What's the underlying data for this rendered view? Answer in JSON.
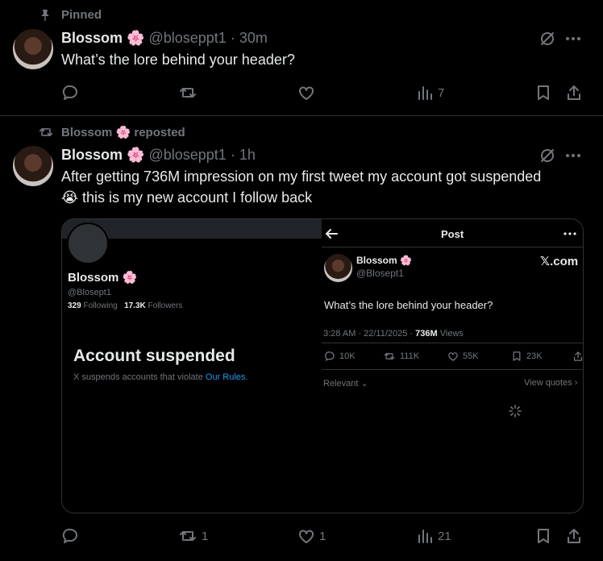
{
  "pinned": {
    "label": "Pinned",
    "tweet": {
      "name": "Blossom",
      "emoji": "🌸",
      "handle": "@bloseppt1",
      "time": "· 30m",
      "text": "What’s the lore behind your header?",
      "views": "7"
    }
  },
  "repost": {
    "label": "Blossom 🌸 reposted",
    "tweet": {
      "name": "Blossom",
      "emoji": "🌸",
      "handle": "@bloseppt1",
      "time": "· 1h",
      "text_line1": "After getting 736M impression on my first tweet my account got suspended",
      "text_line2": "😭 this is my new account I follow back",
      "retweets": "1",
      "likes": "1",
      "views": "21"
    }
  },
  "card": {
    "left": {
      "name": "Blossom 🌸",
      "handle": "@Blosept1",
      "following_count": "329",
      "following_label": "Following",
      "followers_count": "17.3K",
      "followers_label": "Followers",
      "suspended_title": "Account suspended",
      "suspended_text": "X suspends accounts that violate",
      "rules_link": "Our Rules."
    },
    "right": {
      "header_title": "Post",
      "watermark": "𝕏.com",
      "name": "Blossom",
      "emoji": "🌸",
      "handle": "@Blosept1",
      "text": "What’s the lore behind your header?",
      "meta_time": "3:28 AM · 22/11/2025 ·",
      "meta_views_count": "736M",
      "meta_views_label": "Views",
      "replies": "10K",
      "retweets": "111K",
      "likes": "55K",
      "bookmarks": "23K",
      "relevant_label": "Relevant",
      "view_quotes": "View quotes"
    }
  },
  "colors": {
    "background": "#000000",
    "text": "#e7e9ea",
    "muted": "#71767b",
    "link": "#1d9bf0",
    "border": "#2f3336"
  }
}
